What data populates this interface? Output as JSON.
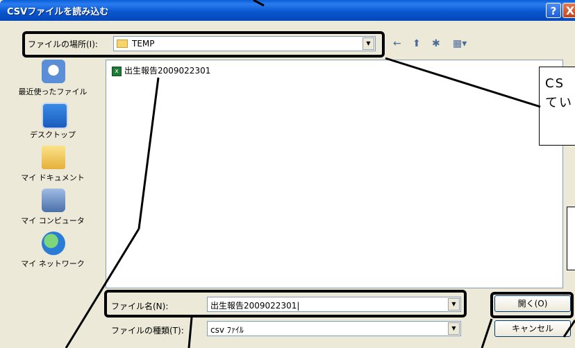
{
  "window": {
    "title": "CSVファイルを読み込む",
    "help": "?",
    "close": "X"
  },
  "lookin": {
    "label": "ファイルの場所(I):",
    "value": "TEMP",
    "dropdown_glyph": "▼"
  },
  "toolbar": {
    "back_icon": "←",
    "up_icon": "⬆",
    "newfolder_icon": "✱",
    "view_icon": "▦▾"
  },
  "places": [
    {
      "label": "最近使ったファイル",
      "icon": "recent-files-icon"
    },
    {
      "label": "デスクトップ",
      "icon": "desktop-icon"
    },
    {
      "label": "マイ ドキュメント",
      "icon": "my-documents-icon"
    },
    {
      "label": "マイ コンピュータ",
      "icon": "my-computer-icon"
    },
    {
      "label": "マイ ネットワーク",
      "icon": "my-network-icon"
    }
  ],
  "files": [
    {
      "name": "出生報告2009022301",
      "icon": "excel-file-icon",
      "icon_glyph": "x"
    }
  ],
  "filename": {
    "label": "ファイル名(N):",
    "value": "出生報告2009022301|",
    "dropdown_glyph": "▼"
  },
  "filetype": {
    "label": "ファイルの種類(T):",
    "value": "csv ﾌｧｲﾙ",
    "dropdown_glyph": "▼"
  },
  "buttons": {
    "open": "開く(O)",
    "cancel": "キャンセル"
  },
  "callout": {
    "line1": "CS",
    "line2": "てい"
  },
  "colors": {
    "title_bar": "#0a57d0",
    "dialog_bg": "#ece9d8",
    "border": "#7f9db9"
  }
}
